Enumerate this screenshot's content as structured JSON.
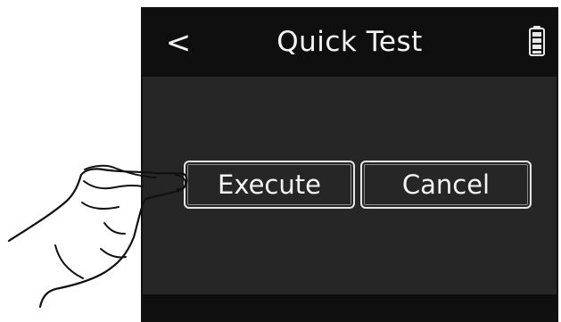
{
  "header": {
    "back_icon": "chevron-left-icon",
    "back_glyph": "<",
    "title": "Quick Test",
    "battery_icon": "battery-icon"
  },
  "actions": {
    "execute_label": "Execute",
    "cancel_label": "Cancel"
  },
  "illustration": {
    "hand_icon": "pointing-hand-icon"
  },
  "colors": {
    "screen_background": "#262626",
    "bar_background": "#0f0f0f",
    "text": "#f4f4f4",
    "button_border": "#e6e6e6"
  }
}
